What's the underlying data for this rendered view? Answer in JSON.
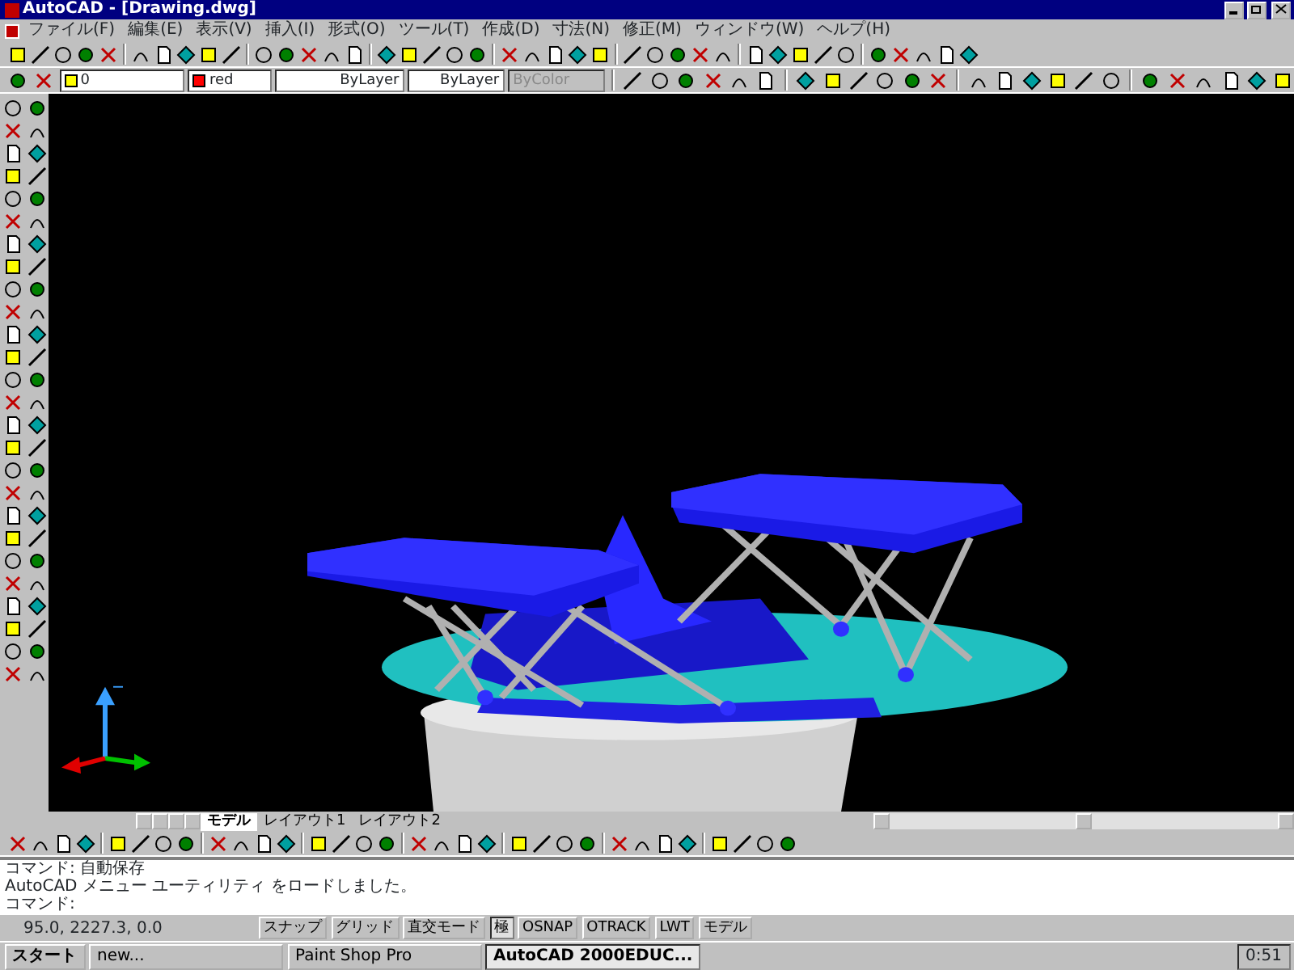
{
  "window": {
    "title": "AutoCAD - [Drawing.dwg]"
  },
  "menu": [
    "ファイル(F)",
    "編集(E)",
    "表示(V)",
    "挿入(I)",
    "形式(O)",
    "ツール(T)",
    "作成(D)",
    "寸法(N)",
    "修正(M)",
    "ウィンドウ(W)",
    "ヘルプ(H)"
  ],
  "layer_toolbar": {
    "layer": "0",
    "color_label": "red",
    "linetype": "ByLayer",
    "lineweight": "ByLayer",
    "plot_style": {
      "value": "ByColor",
      "disabled": true
    }
  },
  "layout_tabs": [
    {
      "label": "モデル",
      "selected": true
    },
    {
      "label": "レイアウト1",
      "selected": false
    },
    {
      "label": "レイアウト2",
      "selected": false
    }
  ],
  "command_lines": [
    "コマンド: 自動保存",
    "AutoCAD メニュー ユーティリティ をロードしました。",
    "コマンド:"
  ],
  "status_bar": {
    "coordinates": "95.0, 2227.3, 0.0",
    "toggles": [
      {
        "label": "スナップ",
        "on": false
      },
      {
        "label": "グリッド",
        "on": false
      },
      {
        "label": "直交モード",
        "on": false
      },
      {
        "label": "極",
        "on": true
      },
      {
        "label": "OSNAP",
        "on": false
      },
      {
        "label": "OTRACK",
        "on": false
      },
      {
        "label": "LWT",
        "on": false
      },
      {
        "label": "モデル",
        "on": false
      }
    ]
  },
  "taskbar": {
    "start": "スタート",
    "tasks": [
      {
        "label": "new...",
        "selected": false
      },
      {
        "label": "Paint Shop Pro",
        "selected": false
      },
      {
        "label": "AutoCAD 2000EDUC...",
        "selected": true
      }
    ],
    "clock": "0:51"
  }
}
